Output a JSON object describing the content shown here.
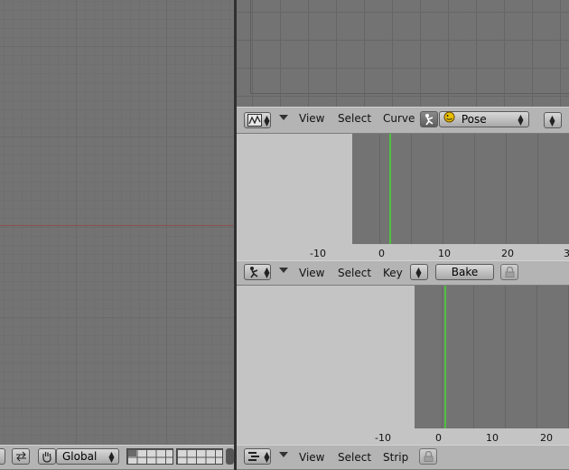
{
  "ipo_header": {
    "menus": [
      "View",
      "Select",
      "Curve"
    ],
    "mode_value": "Pose"
  },
  "action_header": {
    "menus": [
      "View",
      "Select",
      "Key"
    ],
    "bake_label": "Bake"
  },
  "action_ruler": {
    "ticks": [
      "-10",
      "0",
      "10",
      "20",
      "3"
    ]
  },
  "nla_header": {
    "menus": [
      "View",
      "Select",
      "Strip"
    ]
  },
  "nla_ruler": {
    "ticks": [
      "-10",
      "0",
      "10",
      "20"
    ]
  },
  "view3d_header": {
    "orientation_value": "Global"
  },
  "icons": {
    "ipo_editor": "curve-editor-icon",
    "action_editor": "action-editor-icon",
    "nla_editor": "nla-editor-icon",
    "mode": "armature-mode-icon",
    "pose": "pose-ball-icon",
    "lock": "lock-icon",
    "hand": "hand-icon",
    "swap": "swap-icon"
  },
  "colors": {
    "current_frame": "#50c040",
    "x_axis": "#8a5050",
    "pose_icon": "#e8c000"
  }
}
